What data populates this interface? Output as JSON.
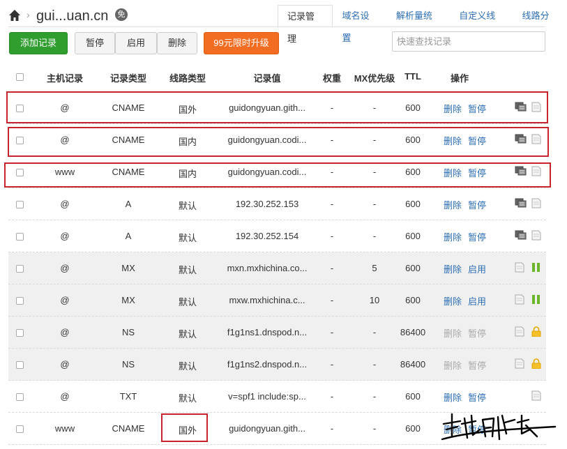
{
  "header": {
    "domain": "gui...uan.cn",
    "badge": "免",
    "tabs": [
      "记录管理",
      "域名设置",
      "解析量统计",
      "自定义线路",
      "线路分组"
    ]
  },
  "toolbar": {
    "add": "添加记录",
    "pause": "暂停",
    "enable": "启用",
    "delete": "删除",
    "upgrade": "99元限时升级",
    "search_placeholder": "快速查找记录"
  },
  "columns": [
    "主机记录",
    "记录类型",
    "线路类型",
    "记录值",
    "权重",
    "MX优先级",
    "TTL",
    "操作"
  ],
  "rows": [
    {
      "host": "@",
      "type": "CNAME",
      "line": "国外",
      "value": "guidongyuan.gith...",
      "weight": "-",
      "mx": "-",
      "ttl": "600",
      "a1": "删除",
      "a2": "暂停",
      "a1_dis": false,
      "a2_dis": false,
      "shaded": false,
      "s1": "remark-icon",
      "s2": "note-icon"
    },
    {
      "host": "@",
      "type": "CNAME",
      "line": "国内",
      "value": "guidongyuan.codi...",
      "weight": "-",
      "mx": "-",
      "ttl": "600",
      "a1": "删除",
      "a2": "暂停",
      "a1_dis": false,
      "a2_dis": false,
      "shaded": false,
      "s1": "remark-icon",
      "s2": "note-icon"
    },
    {
      "host": "www",
      "type": "CNAME",
      "line": "国内",
      "value": "guidongyuan.codi...",
      "weight": "-",
      "mx": "-",
      "ttl": "600",
      "a1": "删除",
      "a2": "暂停",
      "a1_dis": false,
      "a2_dis": false,
      "shaded": false,
      "s1": "remark-icon",
      "s2": "note-icon"
    },
    {
      "host": "@",
      "type": "A",
      "line": "默认",
      "value": "192.30.252.153",
      "weight": "-",
      "mx": "-",
      "ttl": "600",
      "a1": "删除",
      "a2": "暂停",
      "a1_dis": false,
      "a2_dis": false,
      "shaded": false,
      "s1": "remark-icon",
      "s2": "note-icon"
    },
    {
      "host": "@",
      "type": "A",
      "line": "默认",
      "value": "192.30.252.154",
      "weight": "-",
      "mx": "-",
      "ttl": "600",
      "a1": "删除",
      "a2": "暂停",
      "a1_dis": false,
      "a2_dis": false,
      "shaded": false,
      "s1": "remark-icon",
      "s2": "note-icon"
    },
    {
      "host": "@",
      "type": "MX",
      "line": "默认",
      "value": "mxn.mxhichina.co...",
      "weight": "-",
      "mx": "5",
      "ttl": "600",
      "a1": "删除",
      "a2": "启用",
      "a1_dis": false,
      "a2_dis": false,
      "shaded": true,
      "s1": "note-icon",
      "s2": "paused-icon"
    },
    {
      "host": "@",
      "type": "MX",
      "line": "默认",
      "value": "mxw.mxhichina.c...",
      "weight": "-",
      "mx": "10",
      "ttl": "600",
      "a1": "删除",
      "a2": "启用",
      "a1_dis": false,
      "a2_dis": false,
      "shaded": true,
      "s1": "note-icon",
      "s2": "paused-icon"
    },
    {
      "host": "@",
      "type": "NS",
      "line": "默认",
      "value": "f1g1ns1.dnspod.n...",
      "weight": "-",
      "mx": "-",
      "ttl": "86400",
      "a1": "删除",
      "a2": "暂停",
      "a1_dis": true,
      "a2_dis": true,
      "shaded": true,
      "s1": "note-icon",
      "s2": "lock-icon"
    },
    {
      "host": "@",
      "type": "NS",
      "line": "默认",
      "value": "f1g1ns2.dnspod.n...",
      "weight": "-",
      "mx": "-",
      "ttl": "86400",
      "a1": "删除",
      "a2": "暂停",
      "a1_dis": true,
      "a2_dis": true,
      "shaded": true,
      "s1": "note-icon",
      "s2": "lock-icon"
    },
    {
      "host": "@",
      "type": "TXT",
      "line": "默认",
      "value": "v=spf1 include:sp...",
      "weight": "-",
      "mx": "-",
      "ttl": "600",
      "a1": "删除",
      "a2": "暂停",
      "a1_dis": false,
      "a2_dis": false,
      "shaded": false,
      "s1": "",
      "s2": "note-icon"
    },
    {
      "host": "www",
      "type": "CNAME",
      "line": "国外",
      "value": "guidongyuan.gith...",
      "weight": "-",
      "mx": "-",
      "ttl": "600",
      "a1": "删除",
      "a2": "暂停",
      "a1_dis": false,
      "a2_dis": false,
      "shaded": false,
      "s1": "",
      "s2": ""
    }
  ],
  "colors": {
    "link": "#2e6fb5",
    "add_button": "#2f9e2f",
    "upgrade_button": "#f26c22",
    "highlight": "#c8242b"
  }
}
